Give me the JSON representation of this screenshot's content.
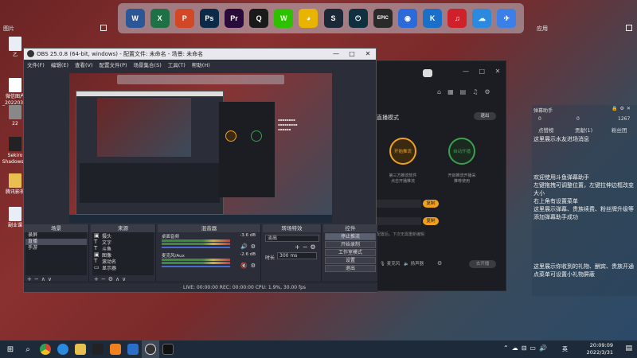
{
  "dock": {
    "apps": [
      {
        "name": "word-icon",
        "label": "W",
        "color": "#2b5797"
      },
      {
        "name": "excel-icon",
        "label": "X",
        "color": "#1e7145"
      },
      {
        "name": "powerpoint-icon",
        "label": "P",
        "color": "#d24726"
      },
      {
        "name": "photoshop-icon",
        "label": "Ps",
        "color": "#0b2a47"
      },
      {
        "name": "premiere-icon",
        "label": "Pr",
        "color": "#2a0a3a"
      },
      {
        "name": "qq-icon",
        "label": "Q",
        "color": "#1a1a1a"
      },
      {
        "name": "wechat-icon",
        "label": "W",
        "color": "#2dc100"
      },
      {
        "name": "cat-game-icon",
        "label": "◕",
        "color": "#e8b400"
      },
      {
        "name": "steam-icon",
        "label": "S",
        "color": "#1b2838"
      },
      {
        "name": "power-app-icon",
        "label": "⏻",
        "color": "#103040"
      },
      {
        "name": "epic-games-icon",
        "label": "EPIC",
        "color": "#2a2a2a"
      },
      {
        "name": "camera-app-icon",
        "label": "◉",
        "color": "#2a6adb"
      },
      {
        "name": "k-app-icon",
        "label": "K",
        "color": "#1a70c8"
      },
      {
        "name": "netease-music-icon",
        "label": "♫",
        "color": "#d0202a"
      },
      {
        "name": "cloud-app-icon",
        "label": "☁",
        "color": "#2a8ae0"
      },
      {
        "name": "feishu-icon",
        "label": "✈",
        "color": "#3a80e8"
      }
    ]
  },
  "desktop": {
    "left_group": "图片",
    "right_group": "应用",
    "icons": [
      {
        "label": "乙"
      },
      {
        "label": "微信图片_202203..."
      },
      {
        "label": "22"
      },
      {
        "label": "Sekiro Shadows..."
      },
      {
        "label": "腾讯影视"
      },
      {
        "label": "副业课"
      }
    ]
  },
  "obs": {
    "title": "OBS 25.0.8 (64-bit, windows) - 配置文件: 未命名 - 场景: 未命名",
    "menu": [
      "文件(F)",
      "编辑(E)",
      "查看(V)",
      "配置文件(P)",
      "场景集合(S)",
      "工具(T)",
      "帮助(H)"
    ],
    "docks": {
      "scenes": {
        "title": "场景",
        "items": [
          "录屏",
          "直播",
          "手游"
        ]
      },
      "sources": {
        "title": "来源",
        "items": [
          "摄头",
          "文字",
          "斗鱼",
          "图像",
          "滚动名",
          "显示器"
        ]
      },
      "mixer": {
        "title": "混音器",
        "tracks": [
          {
            "name": "桌面音频",
            "db": "-3.6 dB"
          },
          {
            "name": "麦克风/Aux",
            "db": "-2.6 dB"
          }
        ]
      },
      "transitions": {
        "title": "转场特效",
        "type": "淡出",
        "duration_label": "时长",
        "duration": "300 ms"
      },
      "controls": {
        "title": "控件",
        "buttons": [
          "停止推流",
          "开始录制",
          "工作室模式",
          "设置",
          "退出"
        ]
      }
    },
    "status": "LIVE: 00:00:00   REC: 00:00:00   CPU: 1.9%, 30.00 fps"
  },
  "streamer": {
    "mode_label": "直播模式",
    "exit_label": "退出",
    "circle_a": "开始推流",
    "circle_b": "自动开播",
    "caption_a": "第三方推流软件\n点击开播推流",
    "caption_b": "开启推流开播采\n推荐使用",
    "hint": "配置后，下次无需重新编辑",
    "copy1": "复制",
    "copy2": "复制",
    "tool1": "麦克风",
    "tool2": "扬声器",
    "go_live": "去开播"
  },
  "chat": {
    "title": "弹幕助手",
    "stats": [
      "0",
      "0",
      "1267"
    ],
    "tabs": [
      "点赞榜",
      "贡献(1)",
      "粉丝团"
    ],
    "messages": [
      "这里展示水友进场消息",
      "欢迎使用斗鱼弹幕助手\n左键拖拽可调整位置，左键拉伸边框改变大小\n右上角有设置菜单\n这里展示弹幕、贵族续费、粉丝牌升级等\n添加弹幕助手成功",
      "这里展示你收到的礼物、酬宾、贵族开通\n点菜单可设置小礼物屏蔽"
    ]
  },
  "taskbar": {
    "time": "20:09:09",
    "date": "2022/3/31",
    "lang": "英"
  }
}
